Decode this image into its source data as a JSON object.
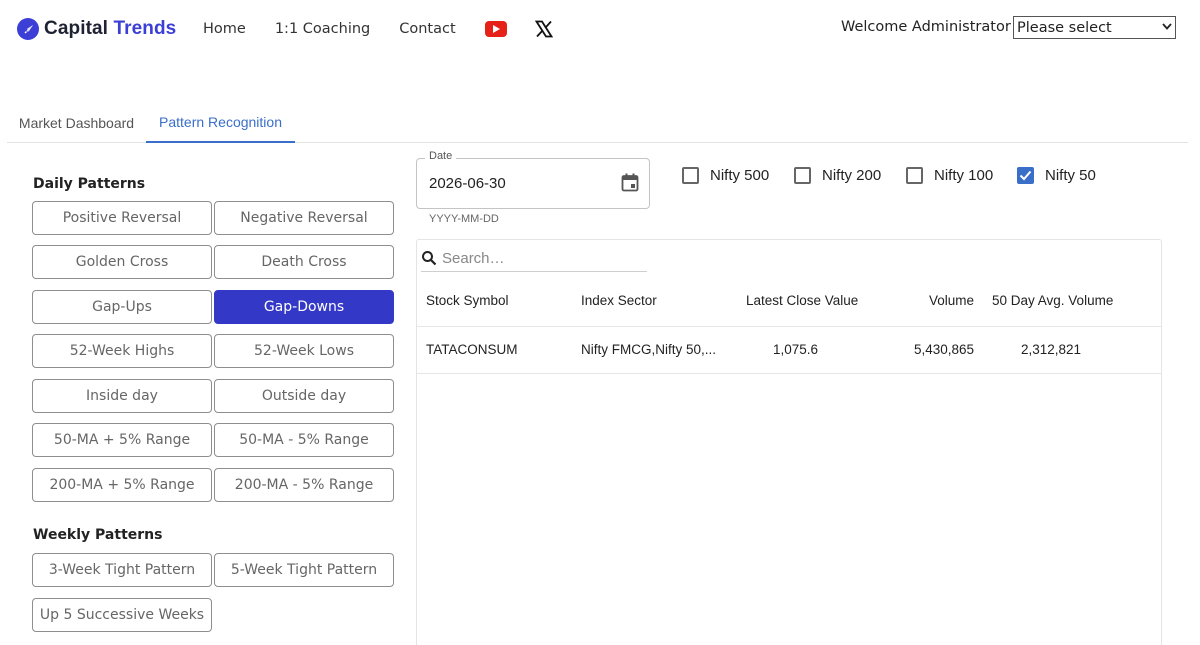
{
  "header": {
    "brand_part1": "Capital",
    "brand_part2": "Trends",
    "nav": [
      "Home",
      "1:1 Coaching",
      "Contact"
    ],
    "welcome": "Welcome Administrator",
    "user_select_value": "Please select",
    "colors": {
      "brand": "#3b3fd6",
      "youtube": "#e62117"
    }
  },
  "tabs": [
    {
      "label": "Market Dashboard",
      "active": false
    },
    {
      "label": "Pattern Recognition",
      "active": true
    }
  ],
  "daily_patterns": {
    "title": "Daily Patterns",
    "buttons": [
      "Positive Reversal",
      "Negative Reversal",
      "Golden Cross",
      "Death Cross",
      "Gap-Ups",
      "Gap-Downs",
      "52-Week Highs",
      "52-Week Lows",
      "Inside day",
      "Outside day",
      "50-MA + 5% Range",
      "50-MA - 5% Range",
      "200-MA + 5% Range",
      "200-MA - 5% Range"
    ],
    "active": "Gap-Downs"
  },
  "weekly_patterns": {
    "title": "Weekly Patterns",
    "buttons": [
      "3-Week Tight Pattern",
      "5-Week Tight Pattern",
      "Up 5 Successive Weeks"
    ]
  },
  "date": {
    "label": "Date",
    "value": "2026-06-30",
    "helper": "YYYY-MM-DD"
  },
  "indices": [
    {
      "label": "Nifty 500",
      "checked": false
    },
    {
      "label": "Nifty 200",
      "checked": false
    },
    {
      "label": "Nifty 100",
      "checked": false
    },
    {
      "label": "Nifty 50",
      "checked": true
    }
  ],
  "table": {
    "search_placeholder": "Search…",
    "columns": [
      "Stock Symbol",
      "Index Sector",
      "Latest Close Value",
      "Volume",
      "50 Day Avg. Volume"
    ],
    "rows": [
      [
        "TATACONSUM",
        "Nifty FMCG,Nifty 50,...",
        "1,075.6",
        "5,430,865",
        "2,312,821"
      ]
    ]
  }
}
